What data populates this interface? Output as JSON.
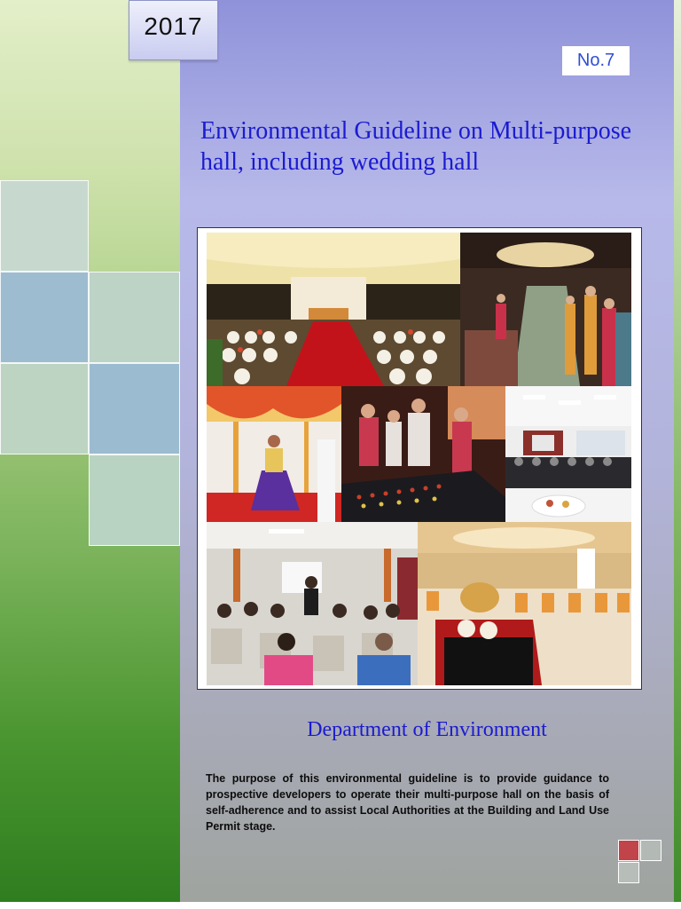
{
  "cover": {
    "year": "2017",
    "number": "No.7",
    "title": "Environmental Guideline on Multi-purpose hall, including wedding hall",
    "department": "Department of Environment",
    "purpose": "The purpose of this environmental guideline is to provide guidance to prospective developers to operate their multi-purpose hall on the basis of self-adherence and to assist Local Authorities at the Building and Land Use Permit stage."
  },
  "photos": [
    {
      "name": "wedding-hall-photo"
    },
    {
      "name": "wedding-guests-photo"
    },
    {
      "name": "dancer-photo"
    },
    {
      "name": "dancing-party-photo"
    },
    {
      "name": "conference-hall-photo"
    },
    {
      "name": "seminar-audience-photo"
    },
    {
      "name": "banquet-hall-photo"
    }
  ],
  "colors": {
    "title_blue": "#1b1bd0",
    "number_blue": "#2f4fd6",
    "accent_red": "#c0444a",
    "green_dark": "#2e7d1f",
    "panel_purple": "#8f92d9"
  }
}
